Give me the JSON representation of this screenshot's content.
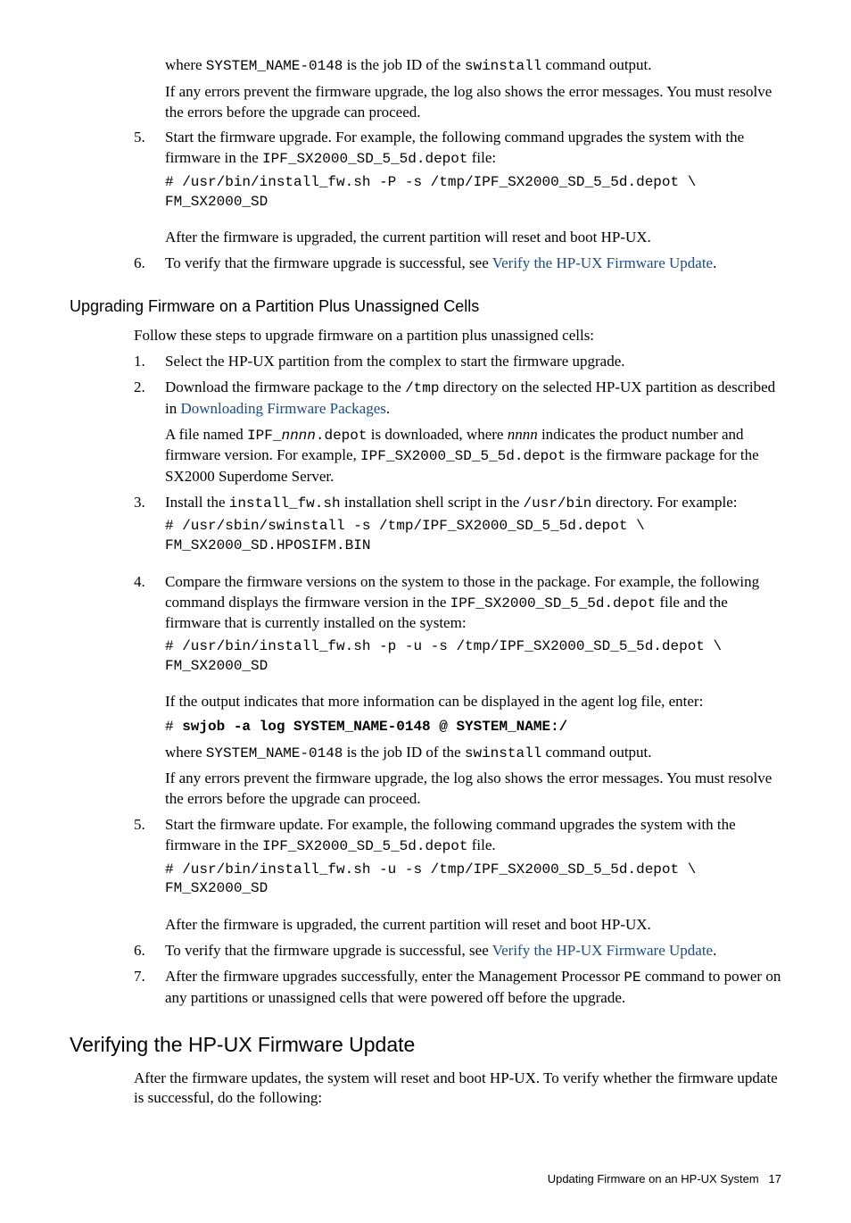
{
  "top": {
    "p1_a": "where ",
    "p1_b": "SYSTEM_NAME-0148",
    "p1_c": " is the job ID of the ",
    "p1_d": "swinstall",
    "p1_e": " command output.",
    "p2": "If any errors prevent the firmware upgrade, the log also shows the error messages. You must resolve the errors before the upgrade can proceed.",
    "step5_a": "Start the firmware upgrade. For example, the following command upgrades the system with the firmware in the ",
    "step5_b": "IPF_SX2000_SD_5_5d.depot",
    "step5_c": " file:",
    "code5": "# /usr/bin/install_fw.sh -P -s /tmp/IPF_SX2000_SD_5_5d.depot \\\nFM_SX2000_SD",
    "step5_after": "After the firmware is upgraded, the current partition will reset and boot HP-UX.",
    "step6_a": "To verify that the firmware upgrade is successful, see ",
    "step6_link": "Verify the HP-UX Firmware Update",
    "step6_b": "."
  },
  "sec1": {
    "title": "Upgrading Firmware on a Partition Plus Unassigned Cells",
    "intro": "Follow these steps to upgrade firmware on a partition plus unassigned cells:",
    "s1": "Select the HP-UX partition from the complex to start the firmware upgrade.",
    "s2_a": "Download the firmware package to the ",
    "s2_b": "/tmp",
    "s2_c": " directory on the selected HP-UX partition as described in ",
    "s2_link": "Downloading Firmware Packages",
    "s2_d": ".",
    "s2_p_a": "A file named ",
    "s2_p_b": "IPF_",
    "s2_p_c": "nnnn",
    "s2_p_d": ".depot",
    "s2_p_e": " is downloaded, where ",
    "s2_p_f": "nnnn",
    "s2_p_g": " indicates the product number and firmware version. For example, ",
    "s2_p_h": "IPF_SX2000_SD_5_5d.depot",
    "s2_p_i": " is the firmware package for the SX2000 Superdome Server.",
    "s3_a": "Install the ",
    "s3_b": "install_fw.sh",
    "s3_c": " installation shell script in the ",
    "s3_d": "/usr/bin",
    "s3_e": " directory. For example:",
    "code3": "# /usr/sbin/swinstall -s /tmp/IPF_SX2000_SD_5_5d.depot \\\nFM_SX2000_SD.HPOSIFM.BIN",
    "s4_a": "Compare the firmware versions on the system to those in the package. For example, the following command displays the firmware version in the ",
    "s4_b": "IPF_SX2000_SD_5_5d.depot",
    "s4_c": " file and the firmware that is currently installed on the system:",
    "code4": "# /usr/bin/install_fw.sh -p -u -s /tmp/IPF_SX2000_SD_5_5d.depot \\\nFM_SX2000_SD",
    "s4_p1": "If the output indicates that more information can be displayed in the agent log file, enter:",
    "s4_cmd_a": "# ",
    "s4_cmd_b": "swjob -a log SYSTEM_NAME-0148 @ SYSTEM_NAME:/",
    "s4_p2_a": "where ",
    "s4_p2_b": "SYSTEM_NAME-0148",
    "s4_p2_c": " is the job ID of the ",
    "s4_p2_d": "swinstall",
    "s4_p2_e": " command output.",
    "s4_p3": "If any errors prevent the firmware upgrade, the log also shows the error messages. You must resolve the errors before the upgrade can proceed.",
    "s5_a": "Start the firmware update. For example, the following command upgrades the system with the firmware in the ",
    "s5_b": "IPF_SX2000_SD_5_5d.depot",
    "s5_c": " file.",
    "code5": "# /usr/bin/install_fw.sh -u -s /tmp/IPF_SX2000_SD_5_5d.depot \\\nFM_SX2000_SD",
    "s5_after": "After the firmware is upgraded, the current partition will reset and boot HP-UX.",
    "s6_a": "To verify that the firmware upgrade is successful, see ",
    "s6_link": "Verify the HP-UX Firmware Update",
    "s6_b": ".",
    "s7_a": "After the firmware upgrades successfully, enter the Management Processor ",
    "s7_b": "PE",
    "s7_c": " command to power on any partitions or unassigned cells that were powered off before the upgrade."
  },
  "sec2": {
    "title": "Verifying the HP-UX Firmware Update",
    "p": "After the firmware updates, the system will reset and boot HP-UX. To verify whether the firmware update is successful, do the following:"
  },
  "footer": {
    "text": "Updating Firmware on an HP-UX System",
    "page": "17"
  }
}
